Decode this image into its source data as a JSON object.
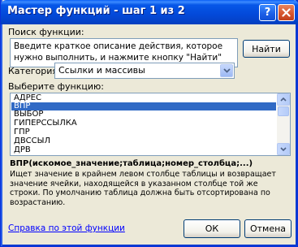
{
  "window": {
    "title": "Мастер функций - шаг 1 из 2",
    "help_glyph": "?",
    "close_glyph": "✕"
  },
  "search": {
    "label": "Поиск функции:",
    "value": "Введите краткое описание действия, которое нужно выполнить, и нажмите кнопку \"Найти\"",
    "find_button": "Найти"
  },
  "category": {
    "label": "Категория:",
    "selected": "Ссылки и массивы"
  },
  "function_list": {
    "label": "Выберите функцию:",
    "items": [
      "АДРЕС",
      "ВПР",
      "ВЫБОР",
      "ГИПЕРССЫЛКА",
      "ГПР",
      "ДВССЫЛ",
      "ДРВ"
    ],
    "selected": "ВПР"
  },
  "details": {
    "signature": "ВПР(искомое_значение;таблица;номер_столбца;...)",
    "description": "Ищет значение в крайнем левом столбце таблицы и возвращает значение ячейки, находящейся в указанном столбце той же строки. По умолчанию таблица должна быть отсортирована по возрастанию."
  },
  "footer": {
    "help_link": "Справка по этой функции",
    "ok_button": "ОК",
    "cancel_button": "Отмена"
  },
  "colors": {
    "titlebar": "#0349D9",
    "dialog_bg": "#ECE9D8",
    "selection": "#316AC5",
    "link": "#0000FF"
  }
}
